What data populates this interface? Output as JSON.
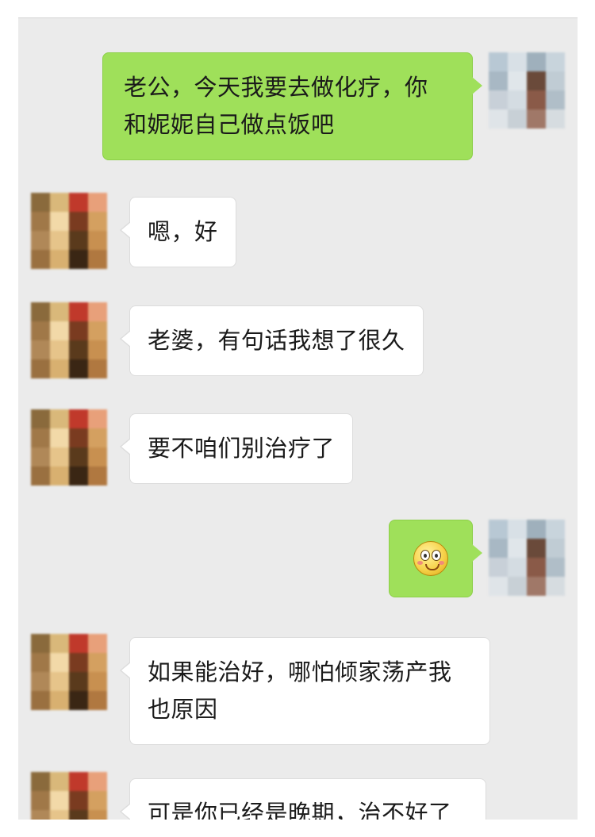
{
  "colors": {
    "chat_background": "#ebebeb",
    "outgoing_bubble": "#9fe05a",
    "incoming_bubble": "#ffffff"
  },
  "messages": [
    {
      "sender": "self",
      "text": "老公，今天我要去做化疗，你\n和妮妮自己做点饭吧"
    },
    {
      "sender": "other",
      "text": "嗯，好"
    },
    {
      "sender": "other",
      "text": "老婆，有句话我想了很久"
    },
    {
      "sender": "other",
      "text": "要不咱们别治疗了"
    },
    {
      "sender": "self",
      "text": "",
      "icon": "embarrassed-face-emoji"
    },
    {
      "sender": "other",
      "text": "如果能治好，哪怕倾家荡产我\n也原因"
    },
    {
      "sender": "other",
      "text": "可是你已经是晚期，治不好了"
    }
  ]
}
